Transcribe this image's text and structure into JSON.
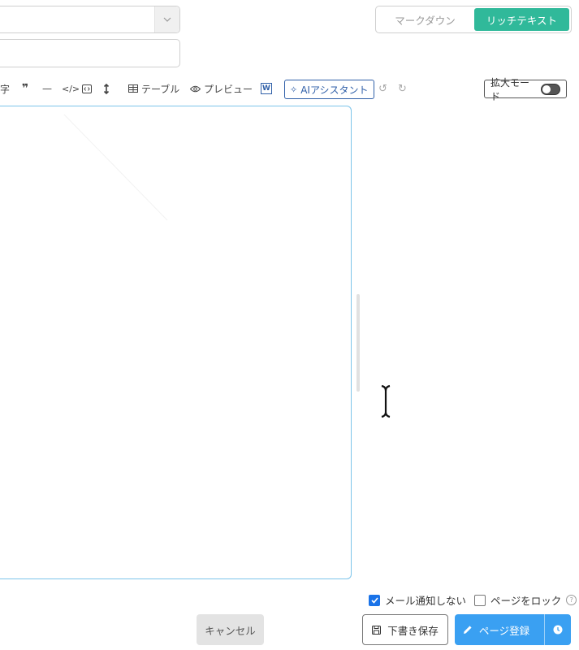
{
  "mode_toggle": {
    "markdown_label": "マークダウン",
    "richtext_label": "リッチテキスト",
    "active": "richtext"
  },
  "toolbar": {
    "char_label": "字",
    "table_label": "テーブル",
    "preview_label": "プレビュー",
    "ai_label": "AIアシスタント",
    "zoom_label": "拡大モード"
  },
  "options": {
    "no_mail_label": "メール通知しない",
    "no_mail_checked": true,
    "lock_label": "ページをロック",
    "lock_checked": false,
    "help_symbol": "?"
  },
  "buttons": {
    "cancel_label": "キャンセル",
    "draft_label": "下書き保存",
    "submit_label": "ページ登録"
  },
  "colors": {
    "accent_green": "#30b99a",
    "primary_blue": "#3aa0f2",
    "editor_border": "#7cc4ea"
  }
}
